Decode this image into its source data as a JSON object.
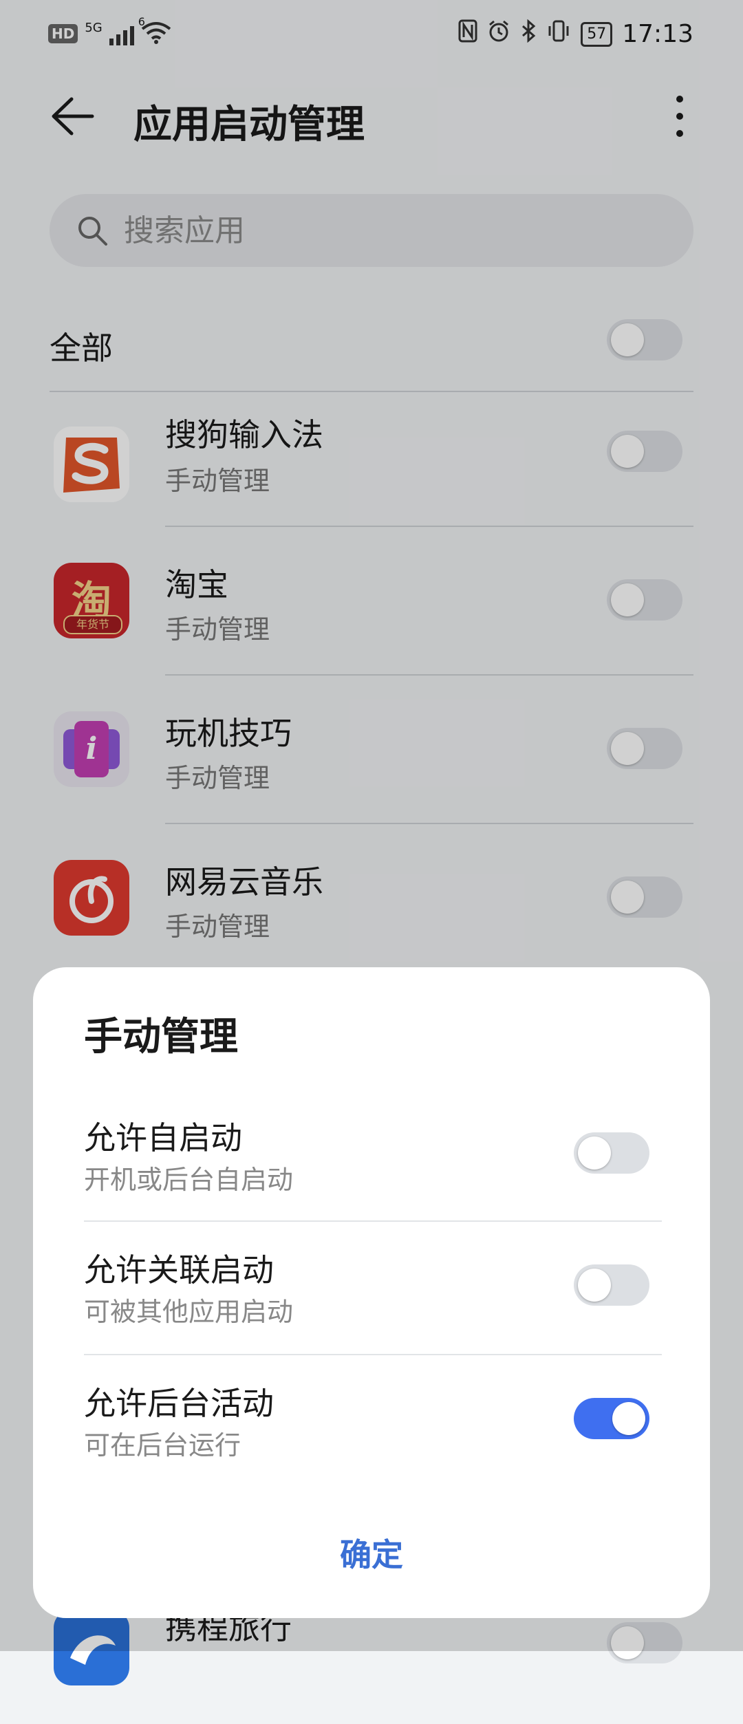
{
  "status_bar": {
    "hd": "HD",
    "network": "5G",
    "wifi_badge": "6",
    "battery": "57",
    "time": "17:13"
  },
  "header": {
    "title": "应用启动管理"
  },
  "search": {
    "placeholder": "搜索应用"
  },
  "all_row": {
    "label": "全部",
    "enabled": false
  },
  "apps": [
    {
      "name": "搜狗输入法",
      "status": "手动管理",
      "icon": "sogou-icon",
      "enabled": false
    },
    {
      "name": "淘宝",
      "status": "手动管理",
      "icon": "taobao-icon",
      "icon_text": "淘",
      "icon_badge": "年货节",
      "enabled": false
    },
    {
      "name": "玩机技巧",
      "status": "手动管理",
      "icon": "tips-icon",
      "icon_text": "i",
      "enabled": false
    },
    {
      "name": "网易云音乐",
      "status": "手动管理",
      "icon": "netease-music-icon",
      "enabled": false
    },
    {
      "name": "携程旅行",
      "status": "",
      "icon": "ctrip-icon",
      "enabled": false
    }
  ],
  "dialog": {
    "title": "手动管理",
    "options": [
      {
        "label": "允许自启动",
        "desc": "开机或后台自启动",
        "enabled": false
      },
      {
        "label": "允许关联启动",
        "desc": "可被其他应用启动",
        "enabled": false
      },
      {
        "label": "允许后台活动",
        "desc": "可在后台运行",
        "enabled": true
      }
    ],
    "confirm_label": "确定"
  },
  "colors": {
    "accent": "#3f6ff0",
    "confirm": "#3a6fd4"
  }
}
